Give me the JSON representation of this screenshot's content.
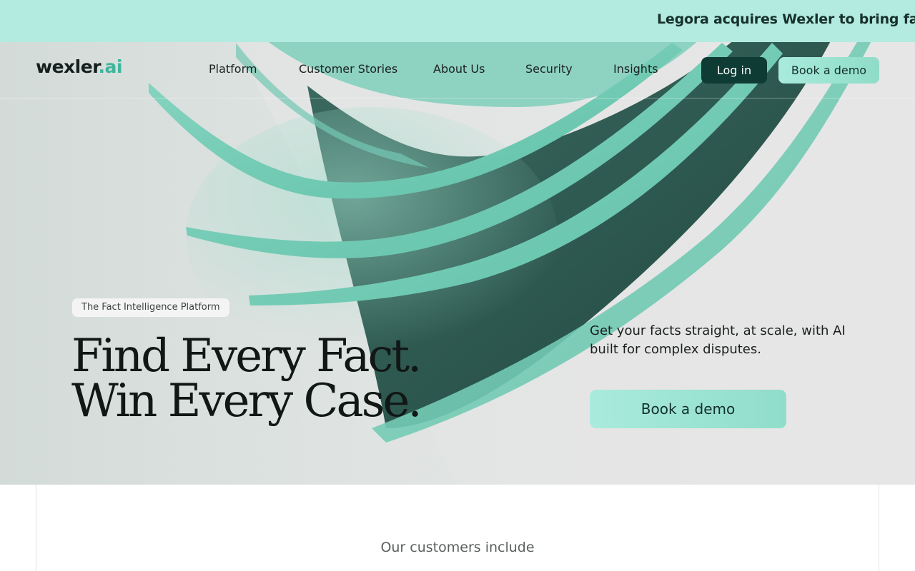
{
  "announcement": {
    "text": "Legora acquires Wexler to bring fact in"
  },
  "nav": {
    "logo_main": "wexler",
    "logo_accent": ".ai",
    "links": [
      "Platform",
      "Customer Stories",
      "About Us",
      "Security",
      "Insights"
    ],
    "login_label": "Log in",
    "demo_label": "Book a demo"
  },
  "hero": {
    "tag": "The Fact Intelligence Platform",
    "headline_line1": "Find Every Fact.",
    "headline_line2": "Win Every Case.",
    "subtext": "Get your facts straight, at scale, with AI built for complex disputes.",
    "cta_label": "Book a demo"
  },
  "customers": {
    "heading": "Our customers include"
  },
  "colors": {
    "accent": "#8fdcc8",
    "banner": "#b3ebe0",
    "dark": "#0e3b33",
    "logo_accent": "#3fb59c"
  }
}
